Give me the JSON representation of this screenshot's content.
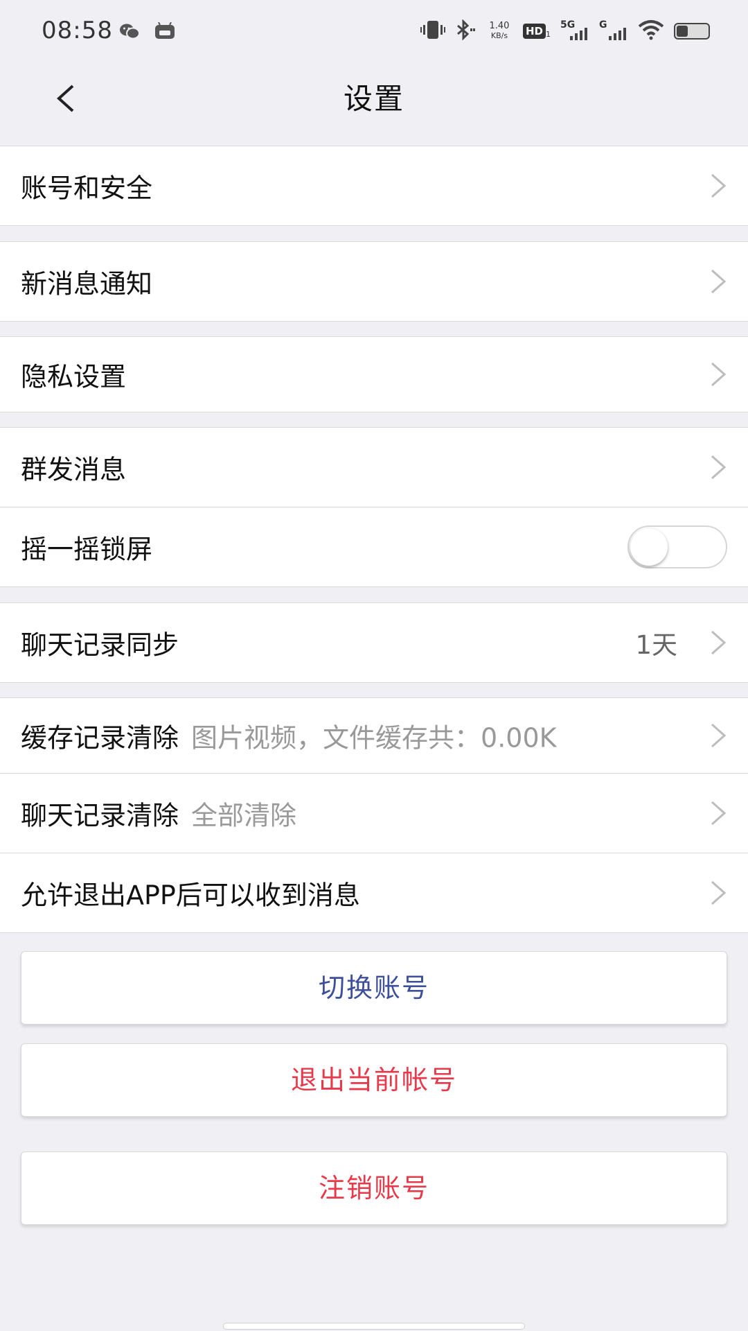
{
  "status_bar": {
    "time": "08:58",
    "net_speed_value": "1.40",
    "net_speed_unit": "KB/s",
    "hd_badge": "HD",
    "hd_sub": "1",
    "signal1_label": "5G",
    "signal2_label": "G",
    "icons": [
      "wechat-icon",
      "app-notification-icon",
      "vibrate-icon",
      "bluetooth-icon",
      "signal-icon",
      "wifi-icon",
      "battery-icon"
    ]
  },
  "header": {
    "title": "设置",
    "back_icon": "chevron-left-icon"
  },
  "settings": {
    "account_security": "账号和安全",
    "new_message_notification": "新消息通知",
    "privacy_settings": "隐私设置",
    "broadcast_message": "群发消息",
    "shake_lock": {
      "label": "摇一摇锁屏",
      "enabled": false
    },
    "chat_sync": {
      "label": "聊天记录同步",
      "value": "1天"
    },
    "cache_clear": {
      "label": "缓存记录清除",
      "detail": "图片视频，文件缓存共：0.00K"
    },
    "chat_clear": {
      "label": "聊天记录清除",
      "detail": "全部清除"
    },
    "background_receive": "允许退出APP后可以收到消息"
  },
  "buttons": {
    "switch_account": "切换账号",
    "logout": "退出当前帐号",
    "deregister": "注销账号"
  },
  "colors": {
    "background": "#efeff4",
    "switch_account_text": "#3d4f9b",
    "danger_text": "#e8394a",
    "secondary_text": "#999999"
  }
}
